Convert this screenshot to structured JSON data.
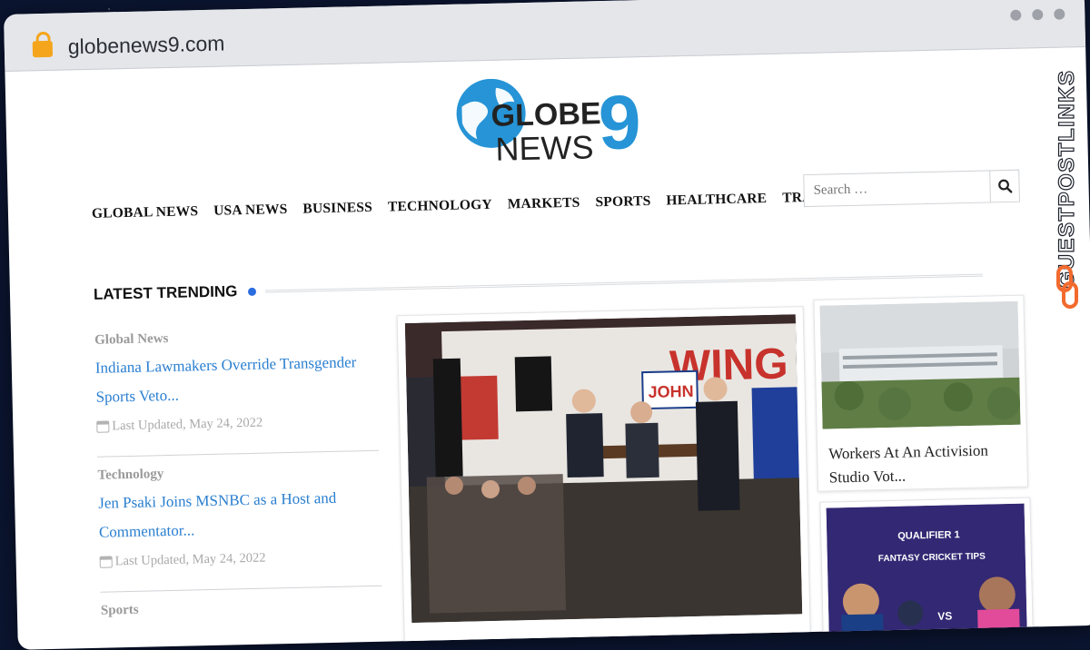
{
  "browser": {
    "url": "globenews9.com"
  },
  "logo": {
    "line1": "GLOBE",
    "digit": "9",
    "line2": "NEWS"
  },
  "nav": {
    "items": [
      {
        "label": "GLOBAL NEWS"
      },
      {
        "label": "USA NEWS"
      },
      {
        "label": "BUSINESS"
      },
      {
        "label": "TECHNOLOGY"
      },
      {
        "label": "MARKETS"
      },
      {
        "label": "SPORTS"
      },
      {
        "label": "HEALTHCARE"
      },
      {
        "label": "TRAVEL"
      }
    ]
  },
  "search": {
    "placeholder": "Search …"
  },
  "section": {
    "title": "LATEST TRENDING"
  },
  "articles": [
    {
      "category": "Global News",
      "title": "Indiana Lawmakers Override Transgender Sports Veto...",
      "updated": "Last Updated, May 24, 2022"
    },
    {
      "category": "Technology",
      "title": "Jen Psaki Joins MSNBC as a Host and Commentator...",
      "updated": "Last Updated, May 24, 2022"
    },
    {
      "category": "Sports"
    }
  ],
  "feature": {
    "sign_text": "JOHN",
    "banner_text": "WING"
  },
  "sidebar": {
    "card1": {
      "caption": "Workers At An Activision Studio Vot..."
    },
    "card2": {
      "headline": "QUALIFIER 1",
      "subhead": "FANTASY CRICKET TIPS",
      "vs": "VS"
    }
  },
  "badge": {
    "text": "GUESTPOSTLINKS"
  },
  "colors": {
    "accent": "#2b6de0",
    "link": "#2a7fd0",
    "lock": "#f4a51c",
    "badge_orange": "#f26a2e"
  }
}
